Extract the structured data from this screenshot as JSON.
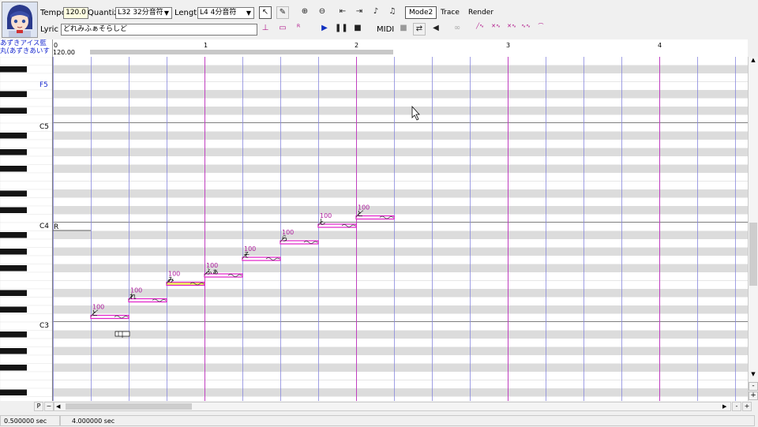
{
  "toolbar": {
    "tempo_label": "Tempo",
    "tempo_value": "120.0",
    "quantize_label": "Quantize",
    "quantize_value": "L32 32分音符",
    "length_label": "Length",
    "length_value": "L4 4分音符",
    "lyric_label": "Lyric",
    "lyric_value": "どれみふぁそらしど",
    "mode_label": "Mode2",
    "trace_label": "Trace",
    "render_label": "Render",
    "midi_label": "MIDI"
  },
  "voice": {
    "name_line1": "あずきアイス藍",
    "name_line2": "丸(あずきあいす",
    "tempo_display": "120.00"
  },
  "ruler": {
    "marks": [
      "0",
      "1",
      "2",
      "3",
      "4"
    ]
  },
  "keyboard": {
    "labels": [
      "F5",
      "C5",
      "C4",
      "C3"
    ]
  },
  "rest_label": "R",
  "notes": [
    {
      "lyric": "ど",
      "velocity": "100",
      "selected": false
    },
    {
      "lyric": "れ",
      "velocity": "100",
      "selected": false
    },
    {
      "lyric": "み",
      "velocity": "100",
      "selected": true
    },
    {
      "lyric": "ふぁ",
      "velocity": "100",
      "selected": false
    },
    {
      "lyric": "そ",
      "velocity": "100",
      "selected": false
    },
    {
      "lyric": "ら",
      "velocity": "100",
      "selected": false
    },
    {
      "lyric": "し",
      "velocity": "100",
      "selected": false
    },
    {
      "lyric": "ど",
      "velocity": "100",
      "selected": false
    }
  ],
  "bottom": {
    "p_label": "P",
    "tilde_label": "~",
    "minus_label": "-",
    "plus_label": "+"
  },
  "status": {
    "time1": "0.500000 sec",
    "time2": "4.000000 sec"
  },
  "colors": {
    "note": "#e020c8",
    "selected_note": "#f0f060",
    "bar_line": "#c040c0",
    "beat_line": "#8888dd",
    "black_row": "#dcdcdc"
  }
}
